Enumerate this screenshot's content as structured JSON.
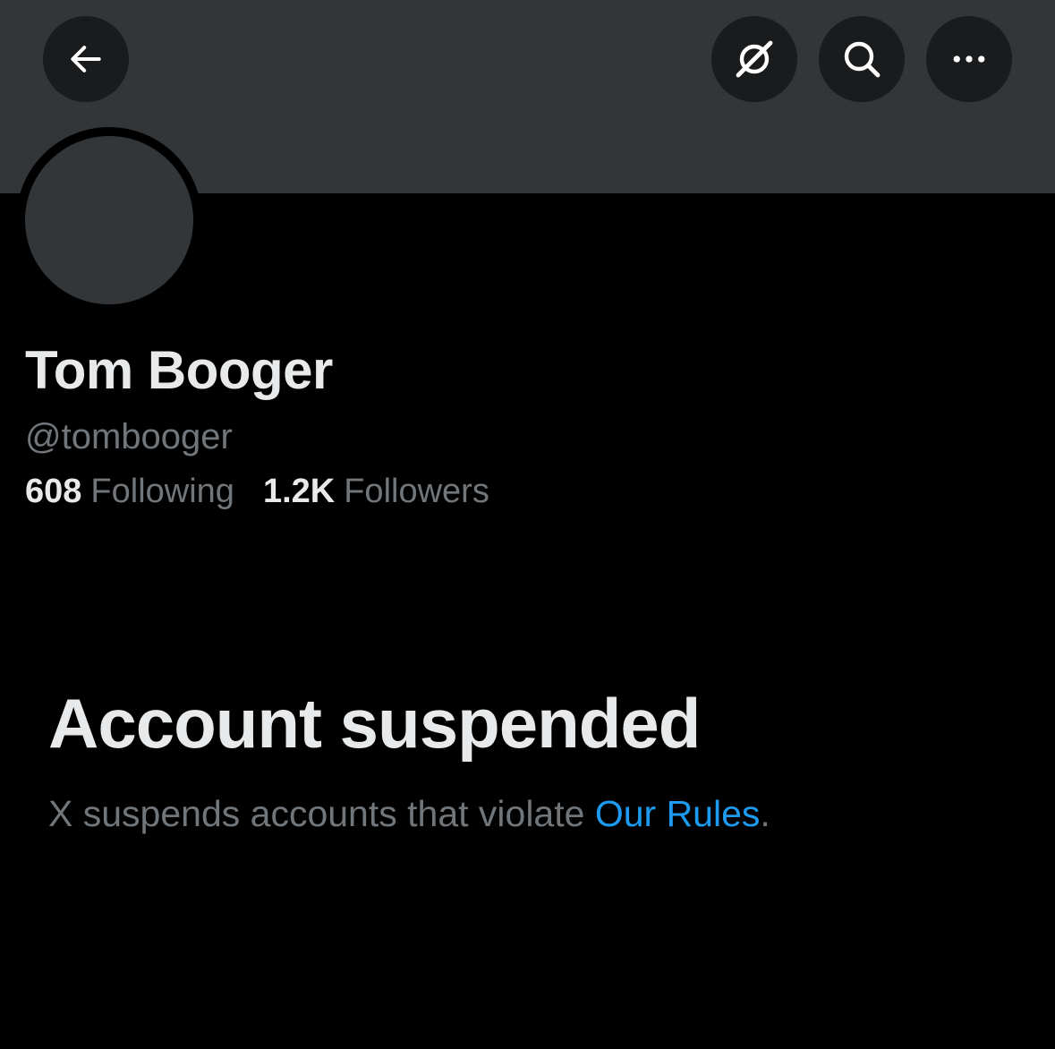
{
  "header": {
    "back_icon": "arrow-left-icon",
    "grok_icon": "grok-slash-icon",
    "search_icon": "search-icon",
    "more_icon": "more-horizontal-icon"
  },
  "profile": {
    "display_name": "Tom Booger",
    "handle": "@tombooger",
    "following_count": "608",
    "following_label": "Following",
    "followers_count": "1.2K",
    "followers_label": "Followers"
  },
  "notice": {
    "title": "Account suspended",
    "description_prefix": "X suspends accounts that violate ",
    "rules_link": "Our Rules",
    "description_suffix": "."
  },
  "colors": {
    "background": "#000000",
    "banner": "#333639",
    "button_bg": "#191b1d",
    "primary_text": "#e7e9ea",
    "secondary_text": "#71767b",
    "link": "#1d9bf0"
  }
}
